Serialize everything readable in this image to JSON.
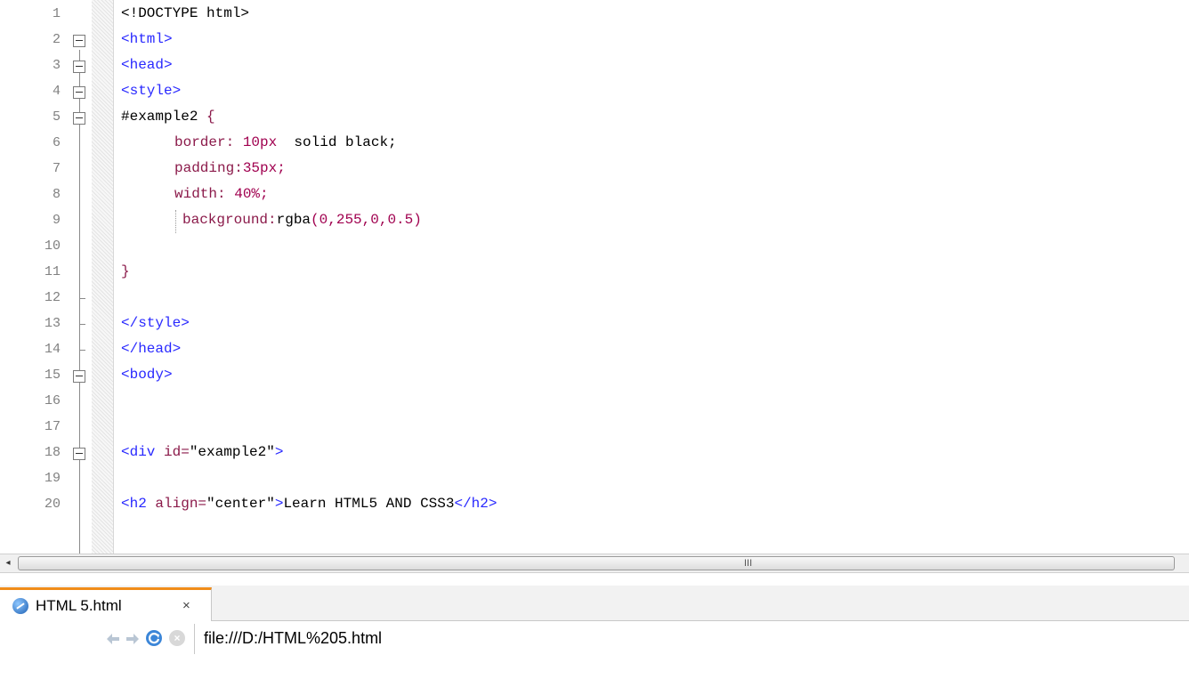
{
  "editor": {
    "lines": [
      {
        "n": "1"
      },
      {
        "n": "2"
      },
      {
        "n": "3"
      },
      {
        "n": "4"
      },
      {
        "n": "5"
      },
      {
        "n": "6"
      },
      {
        "n": "7"
      },
      {
        "n": "8"
      },
      {
        "n": "9"
      },
      {
        "n": "10"
      },
      {
        "n": "11"
      },
      {
        "n": "12"
      },
      {
        "n": "13"
      },
      {
        "n": "14"
      },
      {
        "n": "15"
      },
      {
        "n": "16"
      },
      {
        "n": "17"
      },
      {
        "n": "18"
      },
      {
        "n": "19"
      },
      {
        "n": "20"
      }
    ],
    "code": {
      "l1": "<!DOCTYPE html>",
      "l2": "<html>",
      "l3": "<head>",
      "l4": "<style>",
      "l5_sel": "#example2",
      "l5_brace": " {",
      "l6_prop": "border: ",
      "l6_num": "10px",
      "l6_val": "  solid black;",
      "l7_prop": "padding:",
      "l7_num": "35px;",
      "l8_prop": "width: ",
      "l8_num": "40%;",
      "l9_prop": "background:",
      "l9_fn": "rgba",
      "l9_args": "(0,255,0,0.5)",
      "l11": "}",
      "l13": "</style>",
      "l14": "</head>",
      "l15": "<body>",
      "l18_open": "<div ",
      "l18_attr": "id=",
      "l18_val": "\"example2\"",
      "l18_close": ">",
      "l20_open": "<h2 ",
      "l20_attr": "align=",
      "l20_val": "\"center\"",
      "l20_close": ">",
      "l20_text": "Learn HTML5 AND CSS3",
      "l20_end": "</h2>"
    }
  },
  "scrollbar": {
    "left_arrow": "◂",
    "grip": "III"
  },
  "browser": {
    "tab_label": "HTML 5.html",
    "tab_close": "×",
    "url": "file:///D:/HTML%205.html"
  },
  "icons": {
    "back": "arrow-left-icon",
    "forward": "arrow-right-icon",
    "reload": "reload-icon",
    "stop": "stop-icon",
    "tab": "browser-page-icon"
  },
  "colors": {
    "tag": "#2929ff",
    "property": "#8b1a4a",
    "number": "#a0004f",
    "tab_accent": "#f08c1a"
  }
}
